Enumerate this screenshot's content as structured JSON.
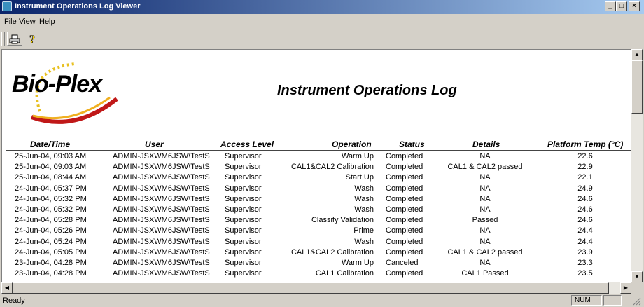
{
  "window": {
    "title": "Instrument Operations Log Viewer"
  },
  "menu": [
    "File",
    "View",
    "Help"
  ],
  "toolbar": {
    "print_icon": "printer-icon",
    "help_icon": "help-icon"
  },
  "report": {
    "logo_text": "Bio-Plex",
    "title": "Instrument Operations Log",
    "columns": [
      "Date/Time",
      "User",
      "Access Level",
      "Operation",
      "Status",
      "Details",
      "Platform Temp (°C)"
    ],
    "rows": [
      [
        "25-Jun-04, 09:03 AM",
        "ADMIN-JSXWM6JSW\\TestS",
        "Supervisor",
        "Warm Up",
        "Completed",
        "NA",
        "22.6"
      ],
      [
        "25-Jun-04, 09:03 AM",
        "ADMIN-JSXWM6JSW\\TestS",
        "Supervisor",
        "CAL1&CAL2 Calibration",
        "Completed",
        "CAL1 & CAL2 passed",
        "22.9"
      ],
      [
        "25-Jun-04, 08:44 AM",
        "ADMIN-JSXWM6JSW\\TestS",
        "Supervisor",
        "Start Up",
        "Completed",
        "NA",
        "22.1"
      ],
      [
        "24-Jun-04, 05:37 PM",
        "ADMIN-JSXWM6JSW\\TestS",
        "Supervisor",
        "Wash",
        "Completed",
        "NA",
        "24.9"
      ],
      [
        "24-Jun-04, 05:32 PM",
        "ADMIN-JSXWM6JSW\\TestS",
        "Supervisor",
        "Wash",
        "Completed",
        "NA",
        "24.6"
      ],
      [
        "24-Jun-04, 05:32 PM",
        "ADMIN-JSXWM6JSW\\TestS",
        "Supervisor",
        "Wash",
        "Completed",
        "NA",
        "24.6"
      ],
      [
        "24-Jun-04, 05:28 PM",
        "ADMIN-JSXWM6JSW\\TestS",
        "Supervisor",
        "Classify Validation",
        "Completed",
        "Passed",
        "24.6"
      ],
      [
        "24-Jun-04, 05:26 PM",
        "ADMIN-JSXWM6JSW\\TestS",
        "Supervisor",
        "Prime",
        "Completed",
        "NA",
        "24.4"
      ],
      [
        "24-Jun-04, 05:24 PM",
        "ADMIN-JSXWM6JSW\\TestS",
        "Supervisor",
        "Wash",
        "Completed",
        "NA",
        "24.4"
      ],
      [
        "24-Jun-04, 05:05 PM",
        "ADMIN-JSXWM6JSW\\TestS",
        "Supervisor",
        "CAL1&CAL2 Calibration",
        "Completed",
        "CAL1 & CAL2 passed",
        "23.9"
      ],
      [
        "23-Jun-04, 04:28 PM",
        "ADMIN-JSXWM6JSW\\TestS",
        "Supervisor",
        "Warm Up",
        "Canceled",
        "NA",
        "23.3"
      ],
      [
        "23-Jun-04, 04:28 PM",
        "ADMIN-JSXWM6JSW\\TestS",
        "Supervisor",
        "CAL1 Calibration",
        "Completed",
        "CAL1 Passed",
        "23.5"
      ]
    ]
  },
  "status": {
    "text": "Ready",
    "num": "NUM",
    "caps": "",
    "scroll": ""
  },
  "colors": {
    "title_start": "#0a246a",
    "title_end": "#a6caf0",
    "rule": "#5c5cff",
    "logo_gold": "#e8c020",
    "logo_red": "#c01818"
  }
}
